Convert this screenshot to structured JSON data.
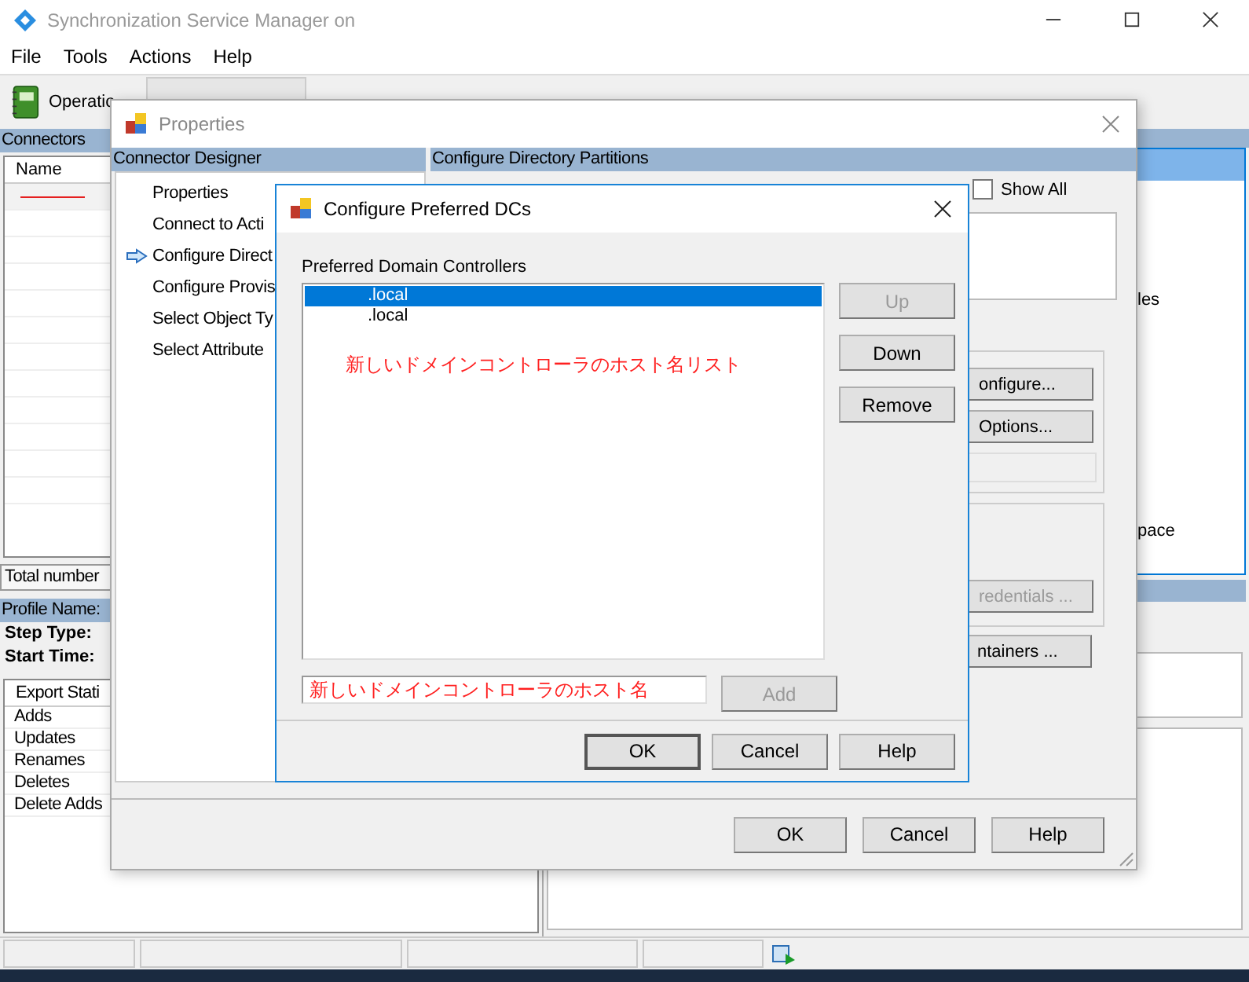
{
  "main_window": {
    "title": "Synchronization Service Manager on",
    "menu": [
      "File",
      "Tools",
      "Actions",
      "Help"
    ],
    "toolbar_label": "Operatio",
    "connectors": {
      "title": "Connectors",
      "column": "Name",
      "total_label": "Total number"
    },
    "profile": {
      "title": "Profile Name:",
      "fields": [
        "Step Type:",
        "Start Time:"
      ]
    },
    "export_table": {
      "column": "Export Stati",
      "rows": [
        "Adds",
        "Updates",
        "Renames",
        "Deletes",
        "Delete Adds"
      ]
    },
    "right_fragments": [
      "les",
      "pace"
    ]
  },
  "properties_dialog": {
    "title": "Properties",
    "designer_header": "Connector Designer",
    "steps": [
      {
        "label": "Properties",
        "selected": false
      },
      {
        "label": "Connect to Acti",
        "selected": false
      },
      {
        "label": "Configure Direct",
        "selected": true
      },
      {
        "label": "Configure Provis",
        "selected": false
      },
      {
        "label": "Select Object Ty",
        "selected": false
      },
      {
        "label": "Select Attribute",
        "selected": false
      }
    ],
    "page_header": "Configure Directory Partitions",
    "show_all": {
      "label": "Show All",
      "checked": false
    },
    "side_buttons": [
      {
        "label": "onfigure...",
        "disabled": false
      },
      {
        "label": "Options...",
        "disabled": false
      }
    ],
    "credentials_button": {
      "label": "redentials ...",
      "disabled": true
    },
    "containers_button": {
      "label": "ntainers ...",
      "disabled": false
    },
    "footer_buttons": [
      "OK",
      "Cancel",
      "Help"
    ]
  },
  "dc_dialog": {
    "title": "Configure Preferred DCs",
    "list_label": "Preferred Domain Controllers",
    "controllers": [
      {
        "name": ".local",
        "selected": true
      },
      {
        "name": ".local",
        "selected": false
      }
    ],
    "annotation": "新しいドメインコントローラのホスト名リスト",
    "side_buttons": [
      {
        "label": "Up",
        "disabled": true
      },
      {
        "label": "Down",
        "disabled": false
      },
      {
        "label": "Remove",
        "disabled": false
      }
    ],
    "host_field": {
      "value": "新しいドメインコントローラのホスト名"
    },
    "add_button": {
      "label": "Add",
      "disabled": true
    },
    "footer_buttons": [
      "OK",
      "Cancel",
      "Help"
    ]
  }
}
